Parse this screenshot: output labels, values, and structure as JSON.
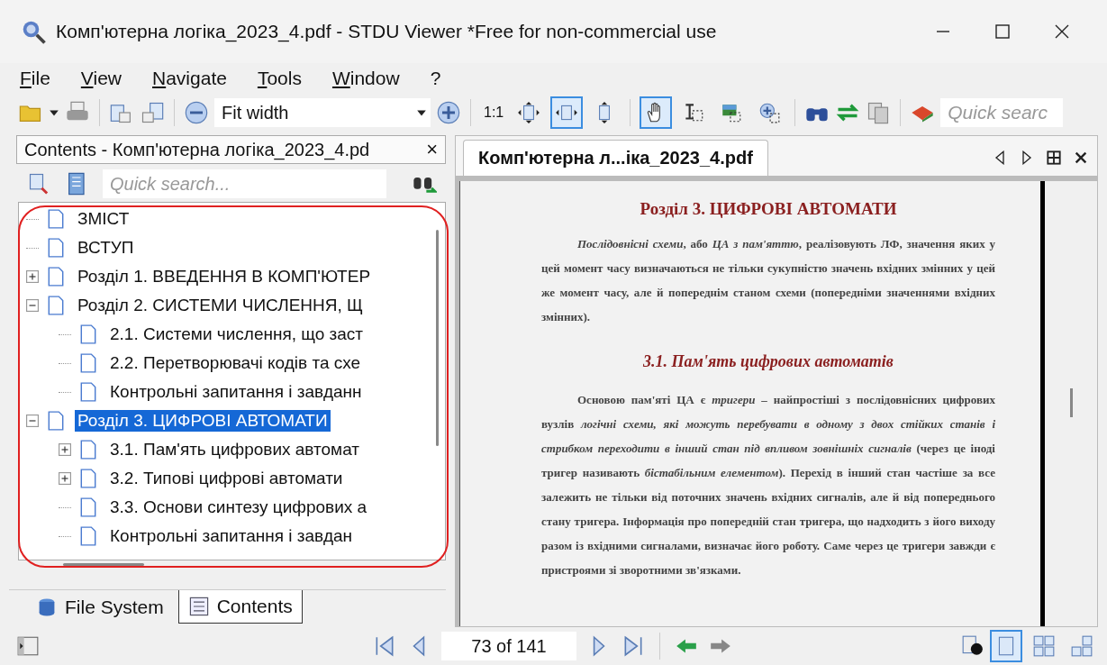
{
  "window": {
    "title": "Комп'ютерна логіка_2023_4.pdf - STDU Viewer *Free for non-commercial use"
  },
  "menu": [
    {
      "label": "File"
    },
    {
      "label": "View"
    },
    {
      "label": "Navigate"
    },
    {
      "label": "Tools"
    },
    {
      "label": "Window"
    },
    {
      "label": "?"
    }
  ],
  "toolbar": {
    "zoom": {
      "value": "Fit width"
    },
    "actual_size": "1:1",
    "fit_modes": [
      {
        "selected": false
      },
      {
        "selected": true
      },
      {
        "selected": false
      }
    ],
    "tools": [
      {
        "selected": true
      },
      {
        "selected": false
      },
      {
        "selected": false
      },
      {
        "selected": false
      }
    ],
    "search": {
      "placeholder": "Quick searc"
    }
  },
  "contents_panel": {
    "title": "Contents - Комп'ютерна логіка_2023_4.pd",
    "close": "×",
    "search": {
      "placeholder": "Quick search..."
    },
    "tree": [
      {
        "label": "ЗМІСТ",
        "kind": "leaf",
        "selected": false
      },
      {
        "label": "ВСТУП",
        "kind": "leaf",
        "selected": false
      },
      {
        "label": "Розділ 1. ВВЕДЕННЯ В КОМП'ЮТЕР",
        "kind": "branch",
        "expanded": false,
        "selected": false
      },
      {
        "label": "Розділ 2. СИСТЕМИ ЧИСЛЕННЯ, Щ",
        "kind": "branch",
        "expanded": true,
        "selected": false,
        "children": [
          {
            "label": "2.1. Системи числення, що заст",
            "kind": "leaf",
            "selected": false
          },
          {
            "label": "2.2. Перетворювачі кодів та схе",
            "kind": "leaf",
            "selected": false
          },
          {
            "label": "Контрольні запитання і завданн",
            "kind": "leaf",
            "selected": false
          }
        ]
      },
      {
        "label": "Розділ 3. ЦИФРОВІ АВТОМАТИ",
        "kind": "branch",
        "expanded": true,
        "selected": true,
        "children": [
          {
            "label": "3.1. Пам'ять цифрових автомат",
            "kind": "branch",
            "expanded": false,
            "selected": false
          },
          {
            "label": "3.2. Типові цифрові автомати",
            "kind": "branch",
            "expanded": false,
            "selected": false
          },
          {
            "label": "3.3. Основи синтезу цифрових а",
            "kind": "leaf",
            "selected": false
          },
          {
            "label": "Контрольні запитання і завдан",
            "kind": "leaf",
            "selected": false
          }
        ]
      }
    ],
    "bottom_tabs": [
      {
        "label": "File System",
        "selected": false
      },
      {
        "label": "Contents",
        "selected": true
      }
    ]
  },
  "document": {
    "tab": {
      "label": "Комп'ютерна л...іка_2023_4.pdf"
    },
    "page": {
      "heading": "Розділ 3. ЦИФРОВІ АВТОМАТИ",
      "intro": "*Послідовнісні схеми*, або *ЦА з пам'яттю*, реалізовують ЛФ, значення яких у цей момент часу визначаються не тільки сукупністю значень вхідних змінних у цей же момент часу, але й попереднім станом схеми (попередніми значеннями вхідних змінних).",
      "subheading": "3.1. Пам'ять цифрових автоматів",
      "body": "Основою пам'яті ЦА є *тригери* – найпростіші з послідовнісних цифрових вузлів *логічні схеми, які можуть перебувати в одному з двох стійких станів і стрибком переходити в інший стан під впливом зовнішніх сигналів* (через це іноді тригер називають *бістабільним елементом*). Перехід в інший стан частіше за все залежить не тільки від поточних значень вхідних сигналів, але й від попереднього стану тригера. Інформація про попередній стан тригера, що надходить з його виходу разом із вхідними сигналами, визначає його роботу. Саме через це тригери завжди є пристроями зі зворотними зв'язками."
    }
  },
  "status_bar": {
    "page_field": {
      "value": "73 of 141"
    },
    "layouts": [
      {
        "selected": true
      },
      {
        "selected": false
      },
      {
        "selected": false
      }
    ]
  }
}
